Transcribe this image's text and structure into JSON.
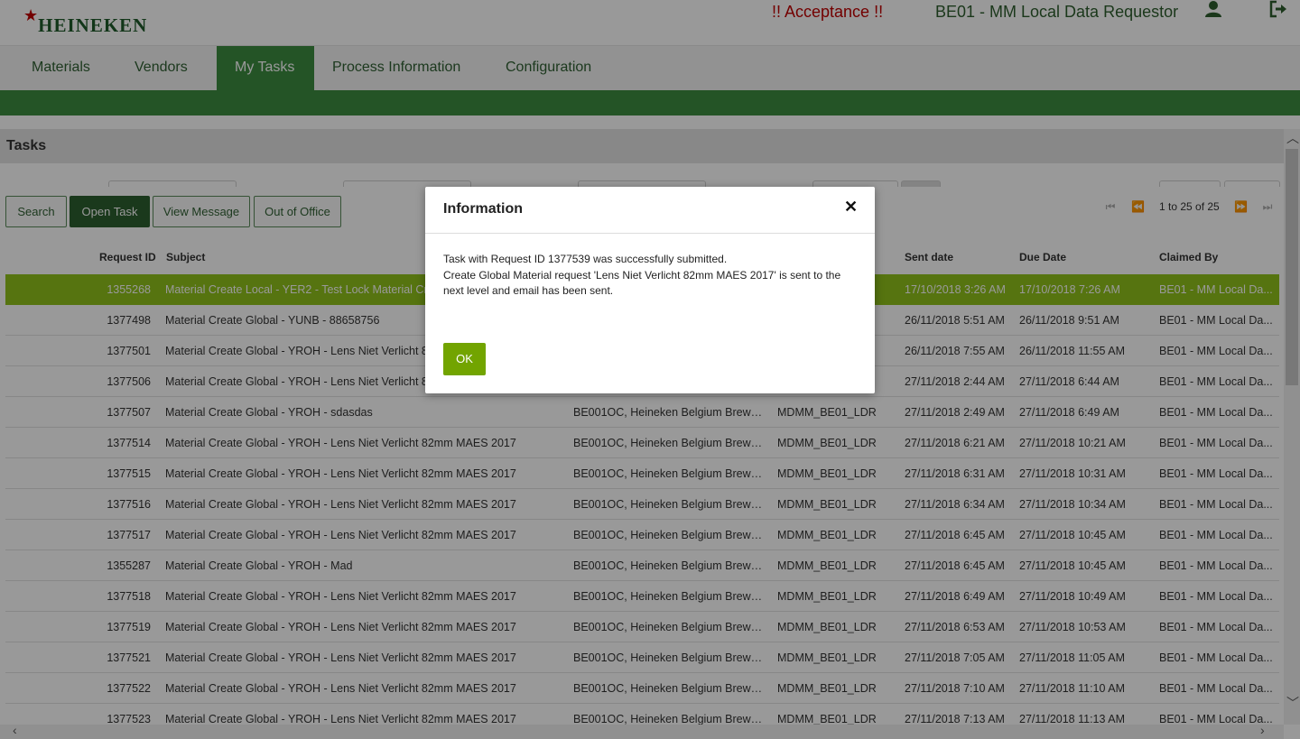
{
  "header": {
    "logo_text": "HEINEKEN",
    "environment": "!! Acceptance !!",
    "role": "BE01 - MM Local Data Requestor",
    "user_icon": "user-icon",
    "logout_icon": "logout-icon"
  },
  "nav": {
    "tabs": [
      {
        "label": "Materials"
      },
      {
        "label": "Vendors"
      },
      {
        "label": "My Tasks",
        "active": true
      },
      {
        "label": "Process Information"
      },
      {
        "label": "Configuration"
      }
    ]
  },
  "tasks": {
    "title": "Tasks",
    "buttons": {
      "search": "Search",
      "open_task": "Open Task",
      "view_message": "View Message",
      "out_of_office": "Out of Office"
    },
    "pager": {
      "range": "1 to 25 of 25"
    },
    "columns": [
      "Request ID",
      "Subject",
      "Sent date",
      "Due Date",
      "Claimed By"
    ],
    "rows": [
      {
        "id": "1355268",
        "subject": "Material Create Local - YER2 - Test Lock Material Cre",
        "vendor": "",
        "group": "",
        "sent": "17/10/2018 3:26 AM",
        "due": "17/10/2018 7:26 AM",
        "claimed": "BE01 - MM Local Da...",
        "selected": true
      },
      {
        "id": "1377498",
        "subject": "Material Create Global - YUNB - 88658756",
        "vendor": "",
        "group": "",
        "sent": "26/11/2018 5:51 AM",
        "due": "26/11/2018 9:51 AM",
        "claimed": "BE01 - MM Local Da..."
      },
      {
        "id": "1377501",
        "subject": "Material Create Global - YROH - Lens Niet Verlicht 82",
        "vendor": "",
        "group": "",
        "sent": "26/11/2018 7:55 AM",
        "due": "26/11/2018 11:55 AM",
        "claimed": "BE01 - MM Local Da..."
      },
      {
        "id": "1377506",
        "subject": "Material Create Global - YROH - Lens Niet Verlicht 82",
        "vendor": "",
        "group": "",
        "sent": "27/11/2018 2:44 AM",
        "due": "27/11/2018 6:44 AM",
        "claimed": "BE01 - MM Local Da..."
      },
      {
        "id": "1377507",
        "subject": "Material Create Global - YROH - sdasdas",
        "vendor": "BE001OC, Heineken Belgium Brewe...",
        "group": "MDMM_BE01_LDR",
        "sent": "27/11/2018 2:49 AM",
        "due": "27/11/2018 6:49 AM",
        "claimed": "BE01 - MM Local Da..."
      },
      {
        "id": "1377514",
        "subject": "Material Create Global - YROH - Lens Niet Verlicht 82mm MAES 2017",
        "vendor": "BE001OC, Heineken Belgium Brewe...",
        "group": "MDMM_BE01_LDR",
        "sent": "27/11/2018 6:21 AM",
        "due": "27/11/2018 10:21 AM",
        "claimed": "BE01 - MM Local Da..."
      },
      {
        "id": "1377515",
        "subject": "Material Create Global - YROH - Lens Niet Verlicht 82mm MAES 2017",
        "vendor": "BE001OC, Heineken Belgium Brewe...",
        "group": "MDMM_BE01_LDR",
        "sent": "27/11/2018 6:31 AM",
        "due": "27/11/2018 10:31 AM",
        "claimed": "BE01 - MM Local Da..."
      },
      {
        "id": "1377516",
        "subject": "Material Create Global - YROH - Lens Niet Verlicht 82mm MAES 2017",
        "vendor": "BE001OC, Heineken Belgium Brewe...",
        "group": "MDMM_BE01_LDR",
        "sent": "27/11/2018 6:34 AM",
        "due": "27/11/2018 10:34 AM",
        "claimed": "BE01 - MM Local Da..."
      },
      {
        "id": "1377517",
        "subject": "Material Create Global - YROH - Lens Niet Verlicht 82mm MAES 2017",
        "vendor": "BE001OC, Heineken Belgium Brewe...",
        "group": "MDMM_BE01_LDR",
        "sent": "27/11/2018 6:45 AM",
        "due": "27/11/2018 10:45 AM",
        "claimed": "BE01 - MM Local Da..."
      },
      {
        "id": "1355287",
        "subject": "Material Create Global - YROH - Mad",
        "vendor": "BE001OC, Heineken Belgium Brewe...",
        "group": "MDMM_BE01_LDR",
        "sent": "27/11/2018 6:45 AM",
        "due": "27/11/2018 10:45 AM",
        "claimed": "BE01 - MM Local Da..."
      },
      {
        "id": "1377518",
        "subject": "Material Create Global - YROH - Lens Niet Verlicht 82mm MAES 2017",
        "vendor": "BE001OC, Heineken Belgium Brewe...",
        "group": "MDMM_BE01_LDR",
        "sent": "27/11/2018 6:49 AM",
        "due": "27/11/2018 10:49 AM",
        "claimed": "BE01 - MM Local Da..."
      },
      {
        "id": "1377519",
        "subject": "Material Create Global - YROH - Lens Niet Verlicht 82mm MAES 2017",
        "vendor": "BE001OC, Heineken Belgium Brewe...",
        "group": "MDMM_BE01_LDR",
        "sent": "27/11/2018 6:53 AM",
        "due": "27/11/2018 10:53 AM",
        "claimed": "BE01 - MM Local Da..."
      },
      {
        "id": "1377521",
        "subject": "Material Create Global - YROH - Lens Niet Verlicht 82mm MAES 2017",
        "vendor": "BE001OC, Heineken Belgium Brewe...",
        "group": "MDMM_BE01_LDR",
        "sent": "27/11/2018 7:05 AM",
        "due": "27/11/2018 11:05 AM",
        "claimed": "BE01 - MM Local Da..."
      },
      {
        "id": "1377522",
        "subject": "Material Create Global - YROH - Lens Niet Verlicht 82mm MAES 2017",
        "vendor": "BE001OC, Heineken Belgium Brewe...",
        "group": "MDMM_BE01_LDR",
        "sent": "27/11/2018 7:10 AM",
        "due": "27/11/2018 11:10 AM",
        "claimed": "BE01 - MM Local Da..."
      },
      {
        "id": "1377523",
        "subject": "Material Create Global - YROH - Lens Niet Verlicht 82mm MAES 2017",
        "vendor": "BE001OC, Heineken Belgium Brewe...",
        "group": "MDMM_BE01_LDR",
        "sent": "27/11/2018 7:13 AM",
        "due": "27/11/2018 11:13 AM",
        "claimed": "BE01 - MM Local Da..."
      }
    ]
  },
  "dialog": {
    "title": "Information",
    "close_icon": "close-icon",
    "message_line1": "Task with Request ID 1377539 was successfully submitted.",
    "message_line2": "Create Global Material request 'Lens Niet Verlicht 82mm MAES 2017' is sent to the next level and email has been sent.",
    "ok_label": "OK"
  },
  "colors": {
    "brand_green": "#3d8c40",
    "dark_green": "#2c5f30",
    "selected_row": "#8fc21b",
    "ok_button": "#72a400",
    "acceptance_red": "#c00000"
  }
}
